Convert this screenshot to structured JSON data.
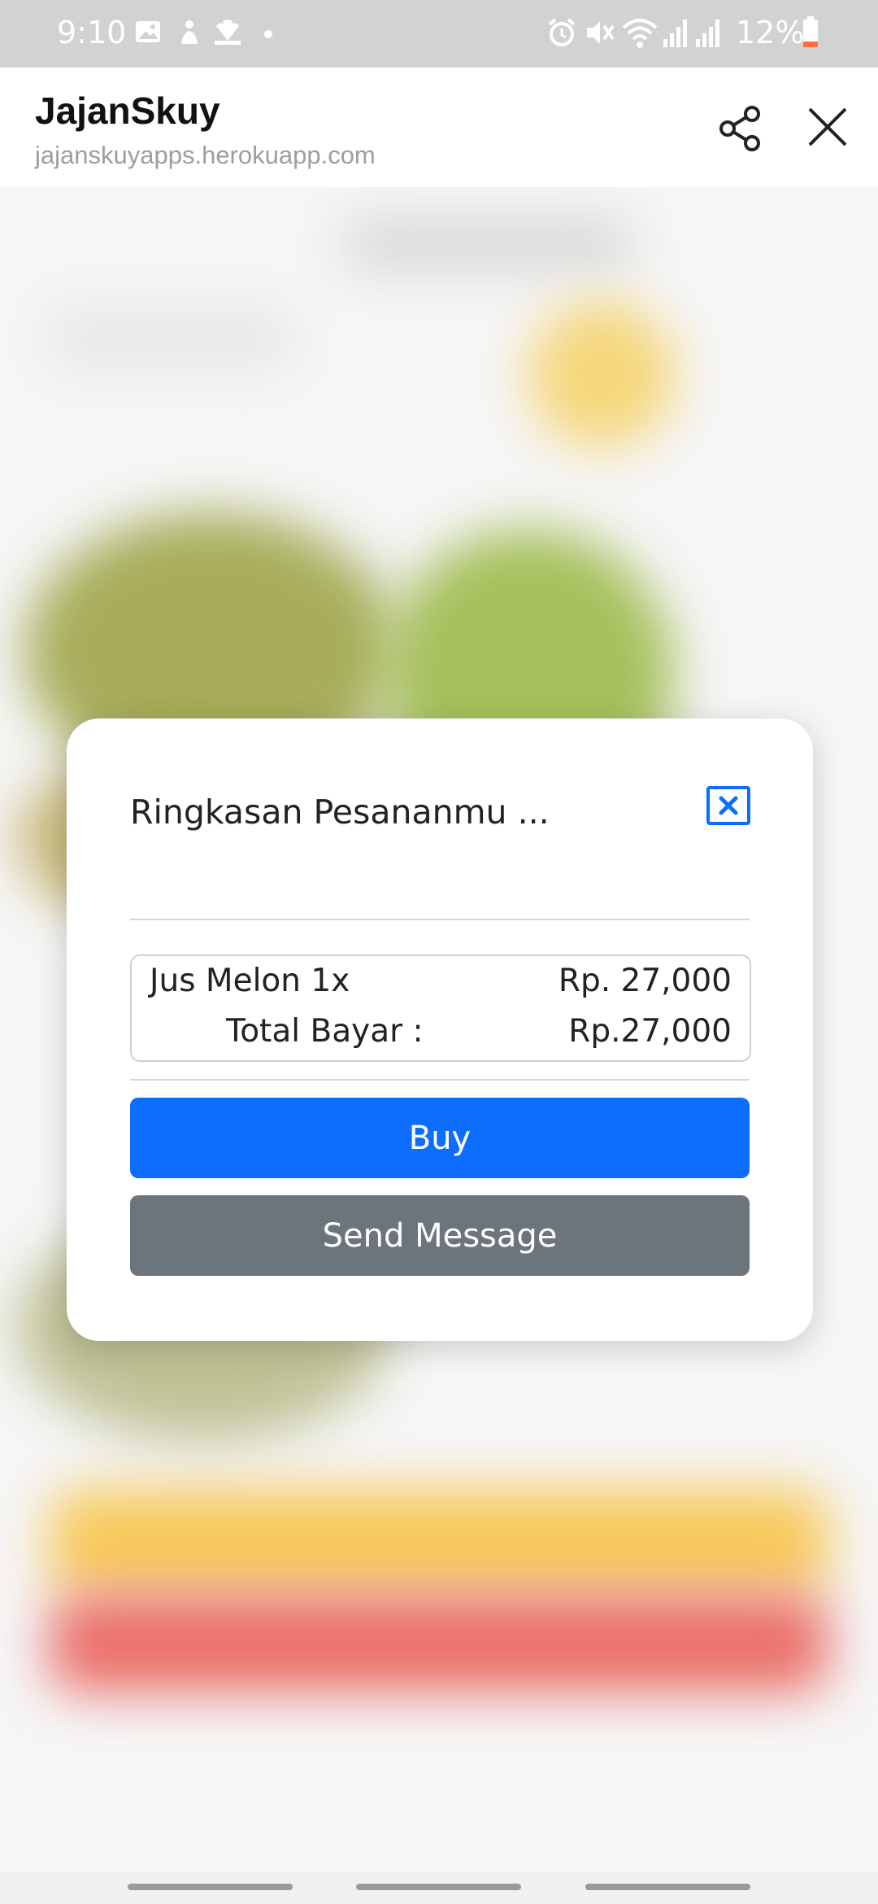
{
  "status_bar": {
    "time": "9:10",
    "battery_percent": "12%",
    "notification_icons": [
      "gallery-icon",
      "bixby-icon",
      "nbc-icon",
      "dot-icon"
    ],
    "system_icons": [
      "alarm-icon",
      "mute-icon",
      "wifi-icon",
      "signal-icon",
      "signal-icon",
      "battery-icon"
    ],
    "battery_color": "#ff6d3a"
  },
  "tab_header": {
    "title": "JajanSkuy",
    "url": "jajanskuyapps.herokuapp.com",
    "share_icon": "share-icon",
    "close_icon": "close-icon"
  },
  "modal": {
    "title": "Ringkasan Pesananmu ...",
    "close_icon": "close-square-icon",
    "item_name": "Jus Melon 1x",
    "item_price": "Rp. 27,000",
    "total_label": "Total Bayar :",
    "total_value": "Rp.27,000",
    "buy_label": "Buy",
    "send_message_label": "Send Message"
  },
  "colors": {
    "primary": "#0d6efd",
    "secondary": "#6c757d",
    "status_bar": "#d2d2d2"
  }
}
